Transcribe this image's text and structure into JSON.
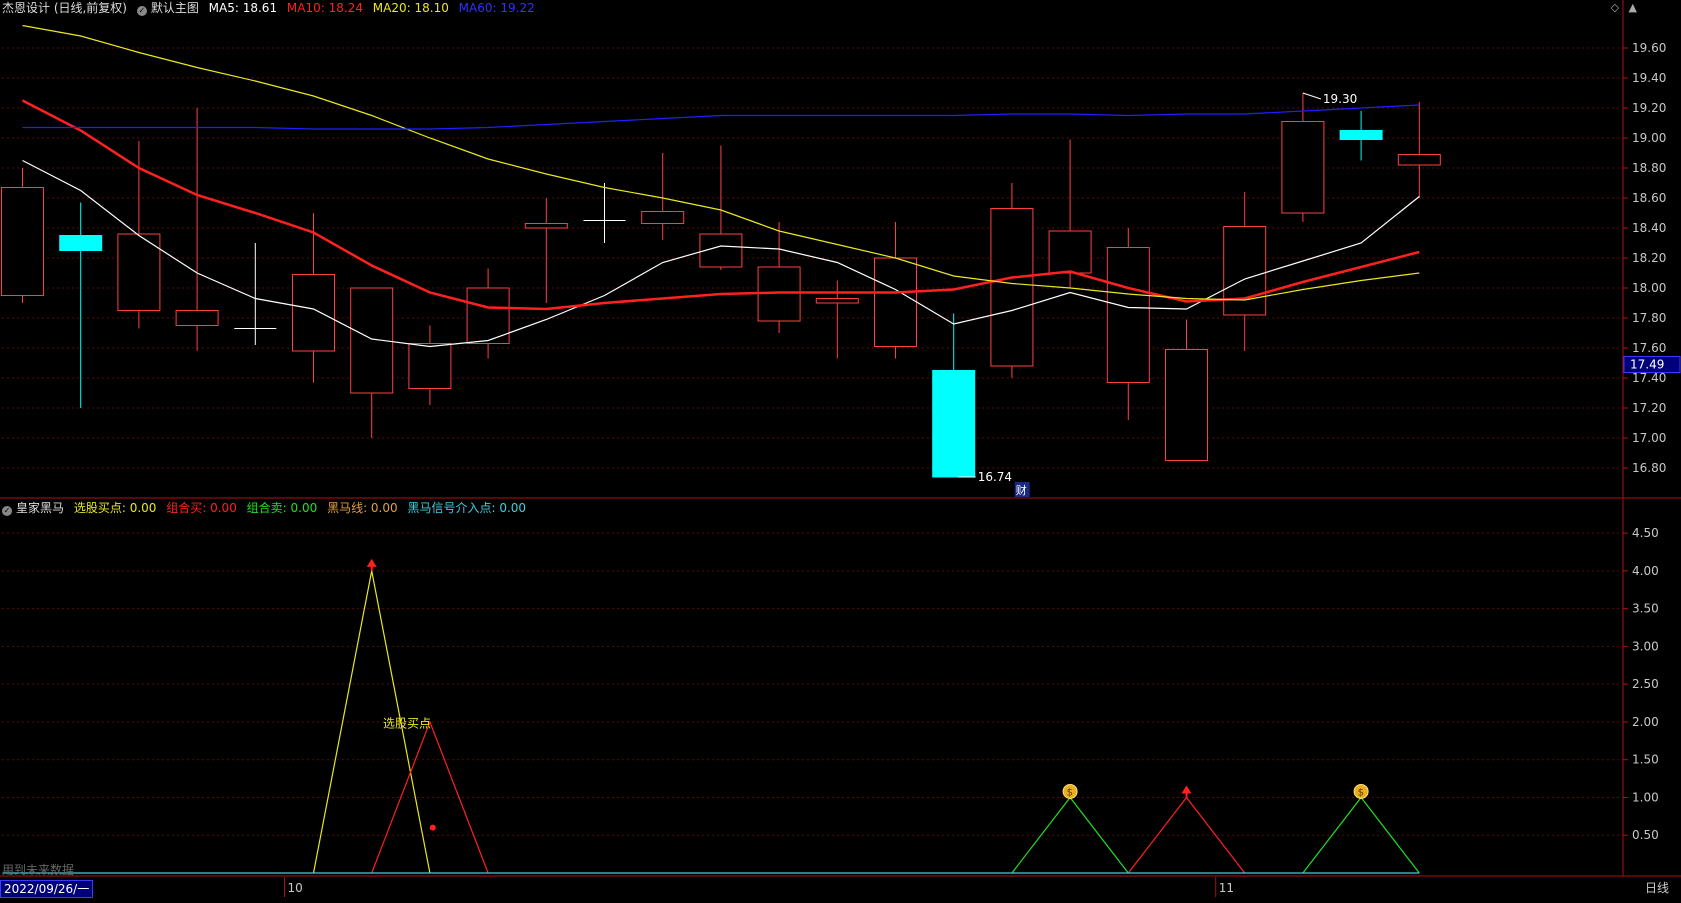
{
  "header": {
    "stock_name": "杰恩设计 (日线,前复权)",
    "main_chart_label": "默认主图",
    "ma": [
      {
        "label": "MA5: 18.61",
        "color": "#ffffff"
      },
      {
        "label": "MA10: 18.24",
        "color": "#ff2020"
      },
      {
        "label": "MA20: 18.10",
        "color": "#e8e820"
      },
      {
        "label": "MA60: 19.22",
        "color": "#2020ff"
      }
    ]
  },
  "indicator_header": {
    "name": "皇家黑马",
    "items": [
      {
        "label": "选股买点: 0.00",
        "color": "#e8e820"
      },
      {
        "label": "组合买: 0.00",
        "color": "#ff2020"
      },
      {
        "label": "组合卖: 0.00",
        "color": "#20e020"
      },
      {
        "label": "黑马线: 0.00",
        "color": "#e0a040"
      },
      {
        "label": "黑马信号介入点: 0.00",
        "color": "#40d0e0"
      }
    ]
  },
  "price_axis": {
    "ticks": [
      "19.60",
      "19.40",
      "19.20",
      "19.00",
      "18.80",
      "18.60",
      "18.40",
      "18.20",
      "18.00",
      "17.80",
      "17.60",
      "17.40",
      "17.20",
      "17.00",
      "16.80"
    ],
    "current_price": "17.49"
  },
  "indicator_axis": {
    "ticks": [
      "4.50",
      "4.00",
      "3.50",
      "3.00",
      "2.50",
      "2.00",
      "1.50",
      "1.00",
      "0.50"
    ]
  },
  "annotations": {
    "high_label": "19.30",
    "low_label": "16.74",
    "cai_label": "财",
    "buy_point_label": "选股买点"
  },
  "time_axis": {
    "date_box": "2022/09/26/一",
    "month_labels": [
      "10",
      "11"
    ],
    "period": "日线"
  },
  "footer_note": "用到未来数据",
  "chart_data": [
    {
      "type": "candlestick",
      "title": "杰恩设计 (日线,前复权)",
      "ylim": [
        16.6,
        19.8
      ],
      "candles": [
        {
          "o": 17.95,
          "h": 18.8,
          "l": 17.9,
          "c": 18.67
        },
        {
          "o": 18.35,
          "h": 18.57,
          "l": 17.2,
          "c": 18.25
        },
        {
          "o": 17.85,
          "h": 18.98,
          "l": 17.73,
          "c": 18.36
        },
        {
          "o": 17.75,
          "h": 19.2,
          "l": 17.58,
          "c": 17.85
        },
        {
          "o": 17.73,
          "h": 18.3,
          "l": 17.62,
          "c": 17.73
        },
        {
          "o": 17.58,
          "h": 18.5,
          "l": 17.37,
          "c": 18.09
        },
        {
          "o": 17.3,
          "h": 18.0,
          "l": 17.0,
          "c": 18.0
        },
        {
          "o": 17.33,
          "h": 17.75,
          "l": 17.22,
          "c": 17.63
        },
        {
          "o": 17.63,
          "h": 18.13,
          "l": 17.53,
          "c": 18.0
        },
        {
          "o": 18.4,
          "h": 18.6,
          "l": 17.9,
          "c": 18.43
        },
        {
          "o": 18.45,
          "h": 18.7,
          "l": 18.3,
          "c": 18.45
        },
        {
          "o": 18.43,
          "h": 18.9,
          "l": 18.32,
          "c": 18.51
        },
        {
          "o": 18.14,
          "h": 18.95,
          "l": 18.12,
          "c": 18.36
        },
        {
          "o": 17.78,
          "h": 18.44,
          "l": 17.7,
          "c": 18.14
        },
        {
          "o": 17.9,
          "h": 18.05,
          "l": 17.53,
          "c": 17.93
        },
        {
          "o": 17.61,
          "h": 18.44,
          "l": 17.53,
          "c": 18.2
        },
        {
          "o": 17.45,
          "h": 17.83,
          "l": 16.74,
          "c": 16.74
        },
        {
          "o": 17.48,
          "h": 18.7,
          "l": 17.4,
          "c": 18.53
        },
        {
          "o": 18.1,
          "h": 18.99,
          "l": 18.0,
          "c": 18.38
        },
        {
          "o": 17.37,
          "h": 18.4,
          "l": 17.12,
          "c": 18.27
        },
        {
          "o": 16.85,
          "h": 17.79,
          "l": 16.85,
          "c": 17.59
        },
        {
          "o": 17.82,
          "h": 18.64,
          "l": 17.58,
          "c": 18.41
        },
        {
          "o": 18.5,
          "h": 19.3,
          "l": 18.44,
          "c": 19.11
        },
        {
          "o": 19.05,
          "h": 19.18,
          "l": 18.85,
          "c": 18.99
        },
        {
          "o": 18.82,
          "h": 19.24,
          "l": 18.6,
          "c": 18.89
        }
      ],
      "ma_series": [
        {
          "name": "MA5",
          "color": "#ffffff",
          "values": [
            18.85,
            18.65,
            18.35,
            18.1,
            17.93,
            17.86,
            17.66,
            17.61,
            17.65,
            17.79,
            17.95,
            18.17,
            18.28,
            18.26,
            18.17,
            17.99,
            17.76,
            17.85,
            17.97,
            17.87,
            17.86,
            18.06,
            18.18,
            18.3,
            18.61
          ]
        },
        {
          "name": "MA10",
          "color": "#ff2020",
          "values": [
            19.25,
            19.05,
            18.8,
            18.62,
            18.5,
            18.37,
            18.15,
            17.97,
            17.87,
            17.86,
            17.9,
            17.93,
            17.96,
            17.97,
            17.97,
            17.97,
            17.99,
            18.07,
            18.11,
            18.0,
            17.91,
            17.93,
            18.04,
            18.14,
            18.24
          ]
        },
        {
          "name": "MA20",
          "color": "#e8e820",
          "values": [
            19.75,
            19.68,
            19.57,
            19.47,
            19.38,
            19.28,
            19.15,
            19.0,
            18.86,
            18.76,
            18.67,
            18.6,
            18.52,
            18.38,
            18.29,
            18.2,
            18.08,
            18.03,
            18.0,
            17.96,
            17.93,
            17.92,
            17.99,
            18.05,
            18.1
          ]
        },
        {
          "name": "MA60",
          "color": "#2020ff",
          "values": [
            19.07,
            19.07,
            19.07,
            19.07,
            19.07,
            19.06,
            19.06,
            19.06,
            19.07,
            19.09,
            19.11,
            19.13,
            19.15,
            19.15,
            19.15,
            19.15,
            19.15,
            19.16,
            19.16,
            19.15,
            19.16,
            19.16,
            19.18,
            19.2,
            19.22
          ]
        }
      ]
    },
    {
      "type": "line",
      "title": "皇家黑马",
      "ylim": [
        0,
        4.7
      ],
      "series": [
        {
          "name": "选股买点",
          "color": "#e8e820",
          "points": [
            [
              5,
              0
            ],
            [
              6,
              4
            ],
            [
              7,
              0
            ]
          ]
        },
        {
          "name": "组合买",
          "color": "#ff2020",
          "points": [
            [
              6,
              0
            ],
            [
              7,
              2
            ],
            [
              8,
              0
            ],
            [
              19,
              0
            ],
            [
              20,
              1
            ],
            [
              21,
              0
            ]
          ]
        },
        {
          "name": "组合卖",
          "color": "#20e020",
          "points": [
            [
              17,
              0
            ],
            [
              18,
              1
            ],
            [
              19,
              0
            ],
            [
              22,
              0
            ],
            [
              23,
              1
            ],
            [
              24,
              0
            ]
          ]
        },
        {
          "name": "黑马线",
          "color": "#40d0e0",
          "points": [
            [
              0,
              0
            ],
            [
              24,
              0
            ]
          ]
        }
      ],
      "markers": [
        {
          "kind": "arrow-up",
          "x": 6,
          "y": 4,
          "color": "#ff2020"
        },
        {
          "kind": "arrow-up",
          "x": 20,
          "y": 1,
          "color": "#ff2020"
        },
        {
          "kind": "dot",
          "x": 7.05,
          "y": 0.6,
          "color": "#ff2020"
        },
        {
          "kind": "coin",
          "x": 18,
          "y": 1,
          "color": "#e8b020"
        },
        {
          "kind": "coin",
          "x": 23,
          "y": 1,
          "color": "#e8b020"
        }
      ],
      "text_marker": {
        "label": "选股买点",
        "x": 6.4,
        "y": 1.98,
        "color": "#e8e820"
      }
    }
  ]
}
